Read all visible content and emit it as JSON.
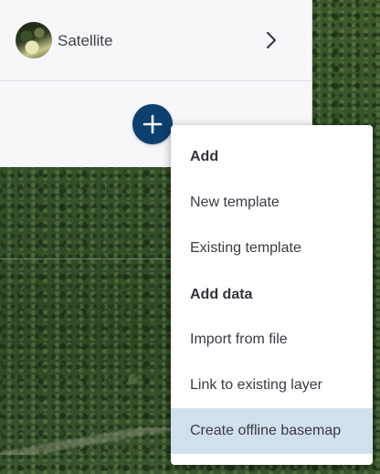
{
  "basemap": {
    "label": "Satellite",
    "thumbnail_icon": "satellite-thumbnail",
    "chevron_icon": "chevron-right-icon"
  },
  "add_button": {
    "icon": "plus-icon",
    "color": "#0d3f6f"
  },
  "menu": {
    "sections": [
      {
        "heading": "Add",
        "items": [
          "New template",
          "Existing template"
        ]
      },
      {
        "heading": "Add data",
        "items": [
          "Import from file",
          "Link to existing layer",
          "Create offline basemap"
        ]
      }
    ],
    "highlighted_item": "Create offline basemap",
    "highlight_color": "#d0e0ec"
  }
}
